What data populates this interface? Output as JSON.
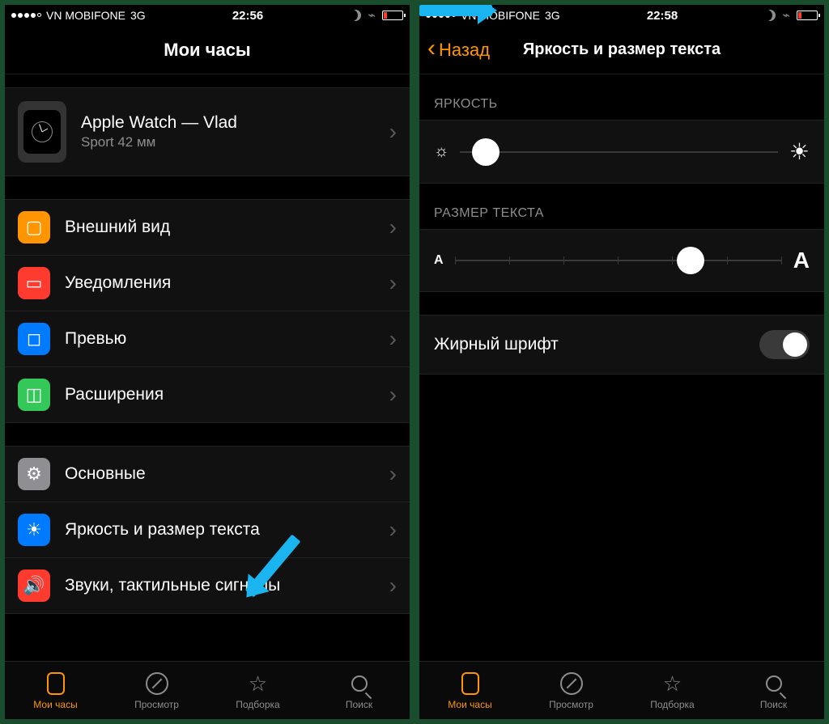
{
  "left": {
    "status": {
      "carrier": "VN MOBIFONE",
      "net": "3G",
      "time": "22:56"
    },
    "nav_title": "Мои часы",
    "device": {
      "name": "Apple Watch — Vlad",
      "model": "Sport 42 мм"
    },
    "section1": [
      {
        "label": "Внешний вид",
        "icon": "appearance",
        "color": "ic-orange"
      },
      {
        "label": "Уведомления",
        "icon": "notifications",
        "color": "ic-red"
      },
      {
        "label": "Превью",
        "icon": "glances",
        "color": "ic-blue"
      },
      {
        "label": "Расширения",
        "icon": "extensions",
        "color": "ic-green"
      }
    ],
    "section2": [
      {
        "label": "Основные",
        "icon": "general",
        "color": "ic-grey"
      },
      {
        "label": "Яркость и размер текста",
        "icon": "brightness",
        "color": "ic-blue"
      },
      {
        "label": "Звуки, тактильные сигналы",
        "icon": "sounds",
        "color": "ic-red"
      }
    ],
    "tabs": [
      {
        "label": "Мои часы",
        "icon": "watch",
        "active": true
      },
      {
        "label": "Просмотр",
        "icon": "compass",
        "active": false
      },
      {
        "label": "Подборка",
        "icon": "star",
        "active": false
      },
      {
        "label": "Поиск",
        "icon": "search",
        "active": false
      }
    ]
  },
  "right": {
    "status": {
      "carrier": "VN MOBIFONE",
      "net": "3G",
      "time": "22:58"
    },
    "back_label": "Назад",
    "nav_title": "Яркость и размер текста",
    "brightness_header": "ЯРКОСТЬ",
    "brightness_value_pct": 8,
    "textsize_header": "РАЗМЕР ТЕКСТА",
    "textsize_value_pct": 72,
    "bold_label": "Жирный шрифт",
    "bold_enabled": false,
    "tabs": [
      {
        "label": "Мои часы",
        "icon": "watch",
        "active": true
      },
      {
        "label": "Просмотр",
        "icon": "compass",
        "active": false
      },
      {
        "label": "Подборка",
        "icon": "star",
        "active": false
      },
      {
        "label": "Поиск",
        "icon": "search",
        "active": false
      }
    ]
  }
}
